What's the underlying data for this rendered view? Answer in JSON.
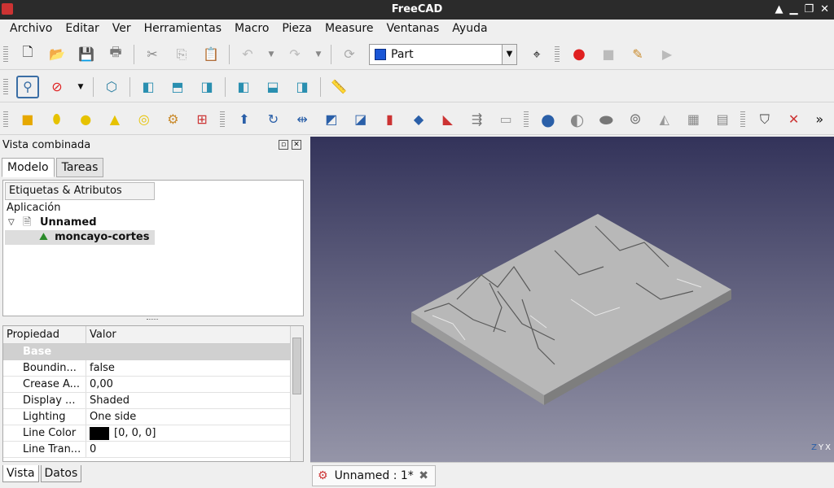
{
  "window": {
    "title": "FreeCAD"
  },
  "menu": [
    "Archivo",
    "Editar",
    "Ver",
    "Herramientas",
    "Macro",
    "Pieza",
    "Measure",
    "Ventanas",
    "Ayuda"
  ],
  "workbench": {
    "selected": "Part"
  },
  "panel": {
    "title": "Vista combinada",
    "tabs": [
      "Modelo",
      "Tareas"
    ],
    "bottom_tabs": [
      "Vista",
      "Datos"
    ]
  },
  "tree": {
    "header": "Etiquetas & Atributos",
    "root": "Aplicación",
    "document": "Unnamed",
    "object": "moncayo-cortes"
  },
  "props": {
    "headers": [
      "Propiedad",
      "Valor"
    ],
    "group": "Base",
    "rows": [
      {
        "name": "Boundin...",
        "value": "false"
      },
      {
        "name": "Crease A...",
        "value": "0,00"
      },
      {
        "name": "Display ...",
        "value": "Shaded"
      },
      {
        "name": "Lighting",
        "value": "One side"
      },
      {
        "name": "Line Color",
        "value": "[0, 0, 0]"
      },
      {
        "name": "Line Tran...",
        "value": "0"
      }
    ]
  },
  "doc_tab": {
    "label": "Unnamed : 1*"
  },
  "colors": {
    "viewport_top": "#33335a",
    "viewport_bottom": "#9595a8",
    "accent_red": "#e02020"
  }
}
